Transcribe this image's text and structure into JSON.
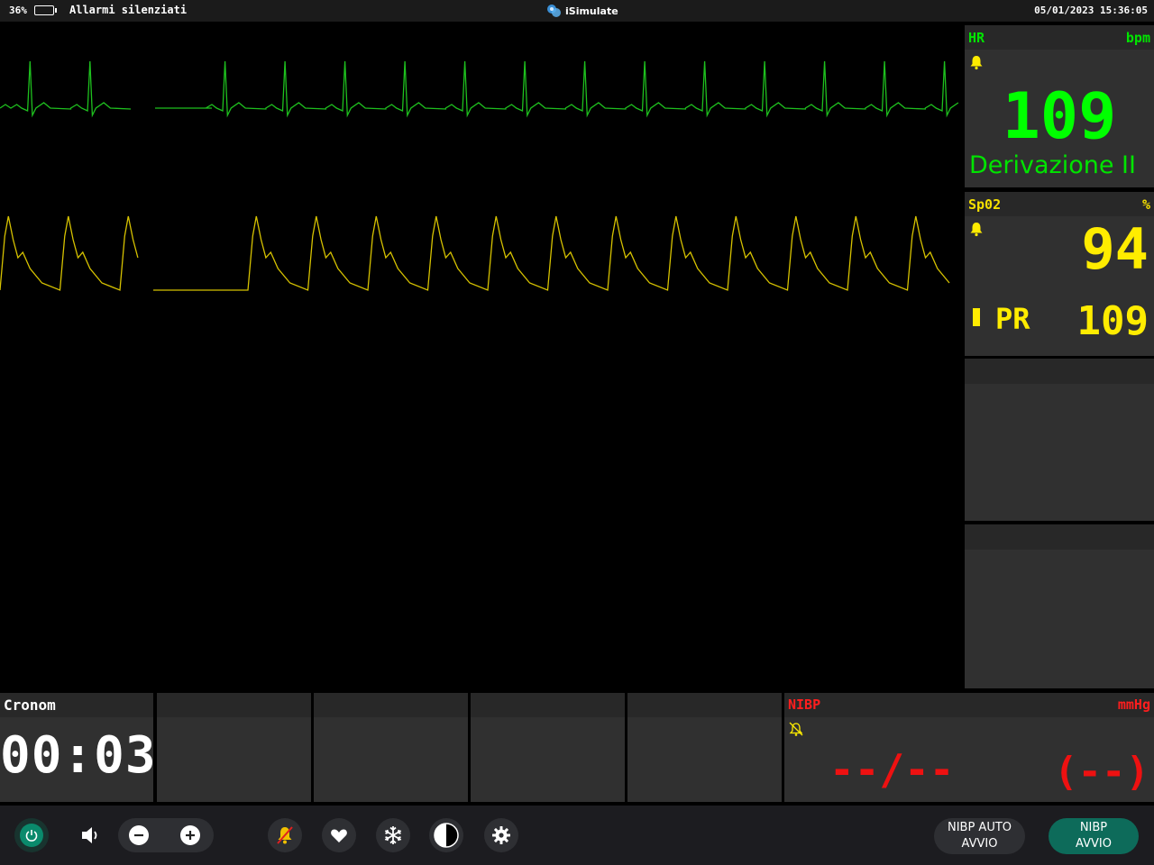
{
  "status_bar": {
    "battery_percent": "36%",
    "alarm_status": "Allarmi silenziati",
    "app_name": "iSimulate",
    "datetime": "05/01/2023 15:36:05"
  },
  "hr": {
    "label": "HR",
    "unit": "bpm",
    "value": "109",
    "lead": "Derivazione II",
    "color": "#00ff00"
  },
  "spo2": {
    "label": "Sp02",
    "unit": "%",
    "value": "94",
    "pr_label": "PR",
    "pr_value": "109",
    "color": "#ffec00"
  },
  "cronom": {
    "label": "Cronom",
    "value": "00:03"
  },
  "nibp": {
    "label": "NIBP",
    "unit": "mmHg",
    "value": "--/--",
    "mean": "(--)",
    "color": "#ee1111"
  },
  "toolbar": {
    "nibp_auto_line1": "NIBP AUTO",
    "nibp_auto_line2": "AVVIO",
    "nibp_start_line1": "NIBP",
    "nibp_start_line2": "AVVIO",
    "icons": [
      "power-icon",
      "speaker-icon",
      "minus-icon",
      "plus-icon",
      "bell-mute-icon",
      "heart-icon",
      "snowflake-icon",
      "contrast-icon",
      "gear-icon"
    ]
  }
}
